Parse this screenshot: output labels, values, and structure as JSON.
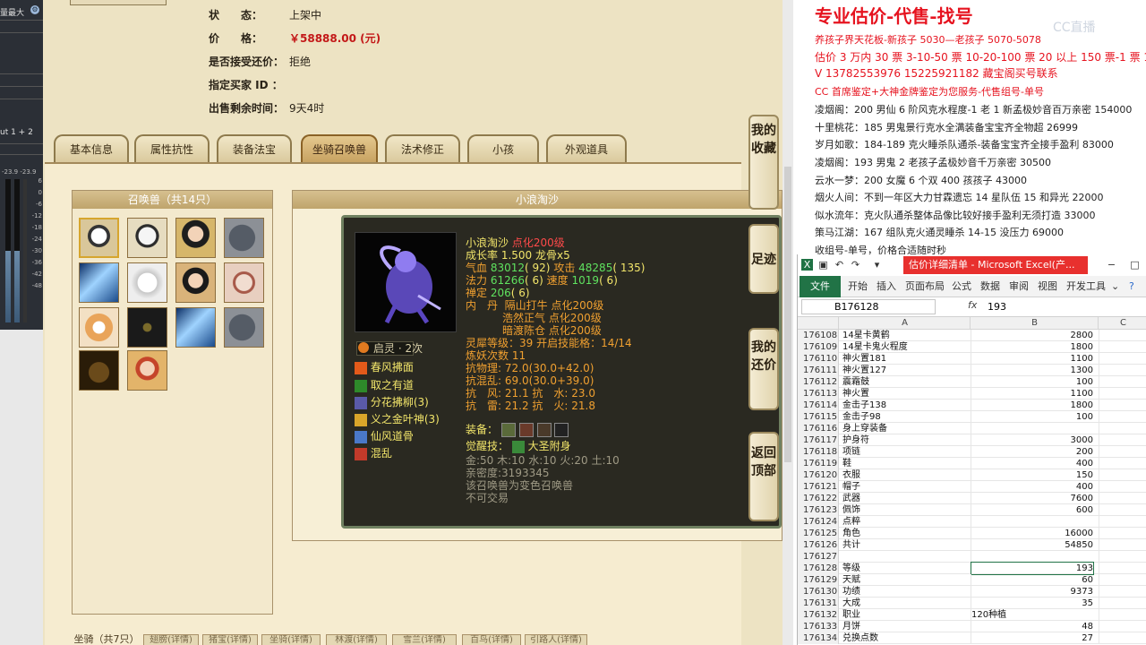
{
  "mixer": {
    "top_label": "量最大",
    "gear": "⚙",
    "track_label": "ut 1 + 2",
    "db_readout": "-23.9 -23.9",
    "scale": [
      "6",
      "0",
      "-6",
      "-12",
      "-18",
      "-24",
      "-30",
      "-36",
      "-42",
      "-48"
    ]
  },
  "game": {
    "info": [
      {
        "label": "状　　态：",
        "value": "上架中",
        "red": false
      },
      {
        "label": "价　　格：",
        "value": "￥58888.00 (元)",
        "red": true
      },
      {
        "label": "是否接受还价：",
        "value": "拒绝",
        "red": false
      },
      {
        "label": "指定买家 ID ：",
        "value": "",
        "red": false
      },
      {
        "label": "出售剩余时间：",
        "value": "9天4时",
        "red": false
      }
    ],
    "tabs": [
      "基本信息",
      "属性抗性",
      "装备法宝",
      "坐骑召唤兽",
      "法术修正",
      "小孩",
      "外观道具"
    ],
    "active_tab": "坐骑召唤兽",
    "pet_list_title": "召唤兽（共14只）",
    "detail_title": "小浪淘沙",
    "pet": {
      "name": "小浪淘沙",
      "rank": "点化200级",
      "growth": "成长率 1.500 龙骨x5",
      "hp_label": "气血",
      "hp": "83012",
      "hp_extra": "( 92)",
      "atk_label": "攻击",
      "atk": "48285",
      "atk_extra": "( 135)",
      "mp_label": "法力",
      "mp": "61266",
      "mp_extra": "( 6)",
      "spd_label": "速度",
      "spd": "1019",
      "spd_extra": "( 6)",
      "zen_label": "禅定",
      "zen": "206",
      "zen_extra": "( 6)",
      "dan_label": "内　丹",
      "dan": [
        {
          "name": "隔山打牛",
          "lv": "点化200级"
        },
        {
          "name": "浩然正气",
          "lv": "点化200级"
        },
        {
          "name": "暗渡陈仓",
          "lv": "点化200级"
        }
      ],
      "xi_level": "灵犀等级：39 开启技能格：14/14",
      "yao_count": "炼妖次数 11",
      "res1": "抗物理: 72.0(30.0+42.0)",
      "res2": "抗混乱: 69.0(30.0+39.0)",
      "res3": "抗　风: 21.1 抗　水: 23.0",
      "res4": "抗　雷: 21.2 抗　火: 21.8",
      "qiling": "启灵 · 2次",
      "skills": [
        "春风拂面",
        "取之有道",
        "分花拂柳(3)",
        "义之金叶神(3)",
        "仙风道骨",
        "混乱"
      ],
      "equip_label": "装备：",
      "awaken_label": "觉醒技：",
      "awaken_skill": "大圣附身",
      "elements": "金:50 木:10 水:10 火:20 土:10",
      "intimacy": "亲密度:3193345",
      "note1": "该召唤兽为变色召唤兽",
      "note2": "不可交易"
    },
    "side_nav": [
      "我的收藏",
      "足迹",
      "我的还价",
      "返回顶部"
    ],
    "bottom_tabs": [
      "坐骑（共7只）",
      "翅膀(详情)",
      "猪宝(详情)",
      "坐骑(详情)",
      "林渡(详情)",
      "雪兰(详情)",
      "百鸟(详情)",
      "引路人(详情)"
    ]
  },
  "notes": {
    "title": "专业估价-代售-找号",
    "lines": [
      {
        "text": "养孩子界天花板-新孩子 5030—老孩子 5070-5078",
        "red": true
      },
      {
        "text": "估价 3 万内 30 票 3-10-50 票 10-20-100 票 20 以上 150 票-1 票 1 元",
        "red": true
      },
      {
        "text": "V 13782553976   15225921182  藏宝阁买号联系",
        "red": true
      },
      {
        "text": "CC 首席鉴定+大神金牌鉴定为您服务-代售组号-单号",
        "red": true
      },
      {
        "text": "凌烟阁：200 男仙 6 阶风克水程度-1 老 1 新孟极妙音百万亲密 154000",
        "red": false
      },
      {
        "text": "十里桃花：185 男鬼景行克水全满装备宝宝齐全物超 26999",
        "red": false
      },
      {
        "text": "岁月如歌：184-189 克火睡杀队通杀-装备宝宝齐全接手盈利 83000",
        "red": false
      },
      {
        "text": "凌烟阁：193 男鬼 2 老孩子孟极妙音千万亲密 30500",
        "red": false
      },
      {
        "text": "云水一梦：200 女魔 6 个双 400 孩孩子 43000",
        "red": false
      },
      {
        "text": "烟火人间：不到一年区大力甘霖遗忘 14 星队伍 15 和异光 22000",
        "red": false
      },
      {
        "text": "似水流年：克火队通杀整体品像比较好接手盈利无须打造 33000",
        "red": false
      },
      {
        "text": "策马江湖：167 组队克火通灵睡杀 14-15 没压力 69000",
        "red": false
      },
      {
        "text": "收组号-单号，价格合适随时秒",
        "red": false
      }
    ],
    "logo": "CC直播"
  },
  "excel": {
    "title": "估价详细清单 - Microsoft Excel(产...",
    "menu": [
      "开始",
      "插入",
      "页面布局",
      "公式",
      "数据",
      "审阅",
      "视图",
      "开发工具"
    ],
    "file_label": "文件",
    "name_box": "B176128",
    "fx": "fx",
    "formula_value": "193",
    "columns": [
      "A",
      "B",
      "C"
    ],
    "rows": [
      {
        "n": "176108",
        "a": "14星卡黄鹤",
        "b": "2800",
        "left": false
      },
      {
        "n": "176109",
        "a": "14星卡鬼火程度",
        "b": "1800",
        "left": false
      },
      {
        "n": "176110",
        "a": "神火置181",
        "b": "1100",
        "left": false
      },
      {
        "n": "176111",
        "a": "神火置127",
        "b": "1300",
        "left": false
      },
      {
        "n": "176112",
        "a": "震霜鼓",
        "b": "100",
        "left": false
      },
      {
        "n": "176113",
        "a": "神火置",
        "b": "1100",
        "left": false
      },
      {
        "n": "176114",
        "a": "金击子138",
        "b": "1800",
        "left": false
      },
      {
        "n": "176115",
        "a": "金击子98",
        "b": "100",
        "left": false
      },
      {
        "n": "176116",
        "a": "身上穿装备",
        "b": "",
        "left": false
      },
      {
        "n": "176117",
        "a": "护身符",
        "b": "3000",
        "left": false
      },
      {
        "n": "176118",
        "a": "项链",
        "b": "200",
        "left": false
      },
      {
        "n": "176119",
        "a": "鞋",
        "b": "400",
        "left": false
      },
      {
        "n": "176120",
        "a": "衣服",
        "b": "150",
        "left": false
      },
      {
        "n": "176121",
        "a": "帽子",
        "b": "400",
        "left": false
      },
      {
        "n": "176122",
        "a": "武器",
        "b": "7600",
        "left": false
      },
      {
        "n": "176123",
        "a": "佩饰",
        "b": "600",
        "left": false
      },
      {
        "n": "176124",
        "a": "点粹",
        "b": "",
        "left": false
      },
      {
        "n": "176125",
        "a": "角色",
        "b": "16000",
        "left": false
      },
      {
        "n": "176126",
        "a": "共计",
        "b": "54850",
        "left": false
      },
      {
        "n": "176127",
        "a": "",
        "b": "",
        "left": false
      },
      {
        "n": "176128",
        "a": "等级",
        "b": "193",
        "left": false
      },
      {
        "n": "176129",
        "a": "天赋",
        "b": "60",
        "left": false
      },
      {
        "n": "176130",
        "a": "功绩",
        "b": "9373",
        "left": false
      },
      {
        "n": "176131",
        "a": "大成",
        "b": "35",
        "left": false
      },
      {
        "n": "176132",
        "a": "职业",
        "b": "120种植",
        "left": true
      },
      {
        "n": "176133",
        "a": "月饼",
        "b": "48",
        "left": false
      },
      {
        "n": "176134",
        "a": "兑换点数",
        "b": "27",
        "left": false
      }
    ]
  }
}
